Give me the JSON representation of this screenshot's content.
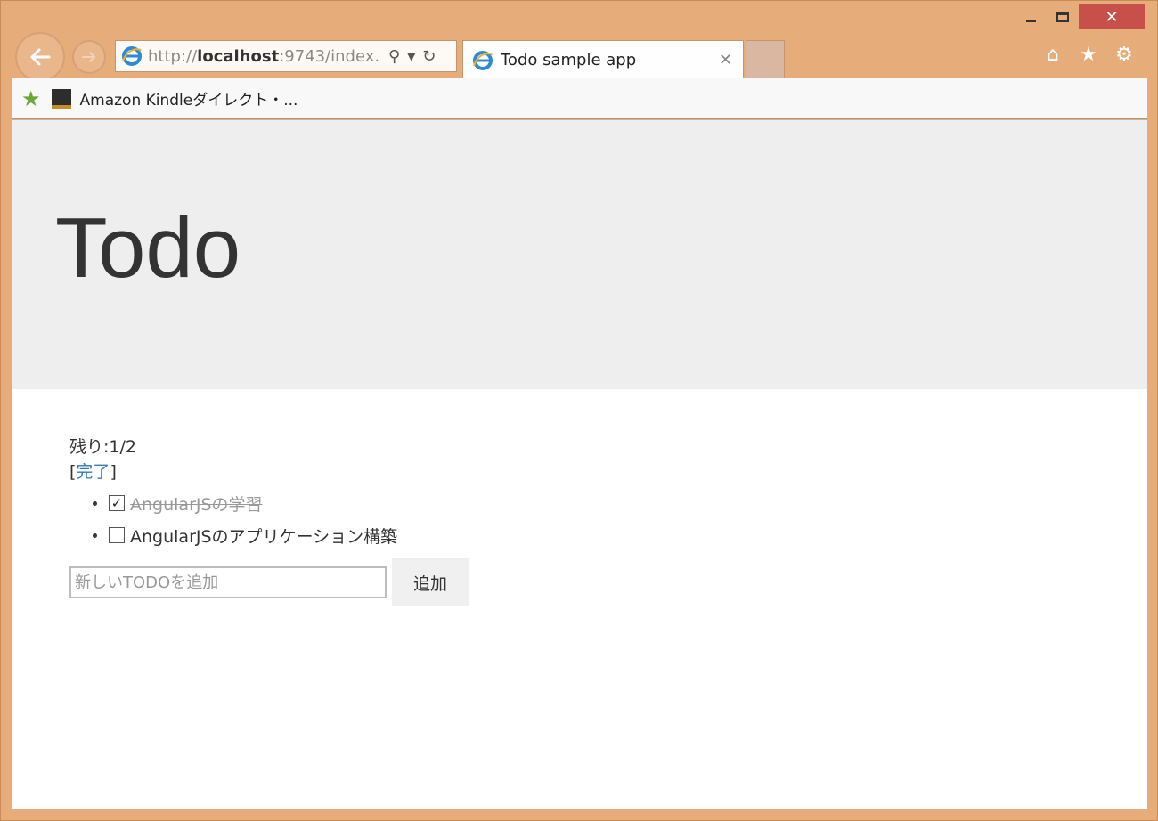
{
  "window": {
    "controls": {
      "minimize": "",
      "maximize": "",
      "close": "✕"
    }
  },
  "nav": {
    "back_icon": "back-arrow-icon",
    "forward_icon": "forward-arrow-icon"
  },
  "address": {
    "url_prefix": "http://",
    "url_host": "localhost",
    "url_rest": ":9743/index.",
    "search_glyph": "⚲",
    "dropdown_glyph": "▾",
    "refresh_glyph": "↻"
  },
  "tab": {
    "title": "Todo sample app",
    "close_glyph": "✕"
  },
  "toolbar": {
    "home_glyph": "⌂",
    "favorites_glyph": "★",
    "settings_glyph": "⚙"
  },
  "favorites": {
    "star_glyph": "★",
    "items": [
      {
        "label": "Amazon Kindleダイレクト・..."
      }
    ]
  },
  "page": {
    "heading": "Todo",
    "remaining": "残り:1/2",
    "archive_prefix": "[",
    "archive_label": "完了",
    "archive_suffix": "]",
    "todos": [
      {
        "text": "AngularJSの学習",
        "done": true
      },
      {
        "text": "AngularJSのアプリケーション構築",
        "done": false
      }
    ],
    "input_placeholder": "新しいTODOを追加",
    "add_button": "追加"
  },
  "colors": {
    "frame": "#e6ad7b",
    "close_button": "#c7504a",
    "jumbotron": "#eeeeee",
    "link": "#337ab7"
  }
}
